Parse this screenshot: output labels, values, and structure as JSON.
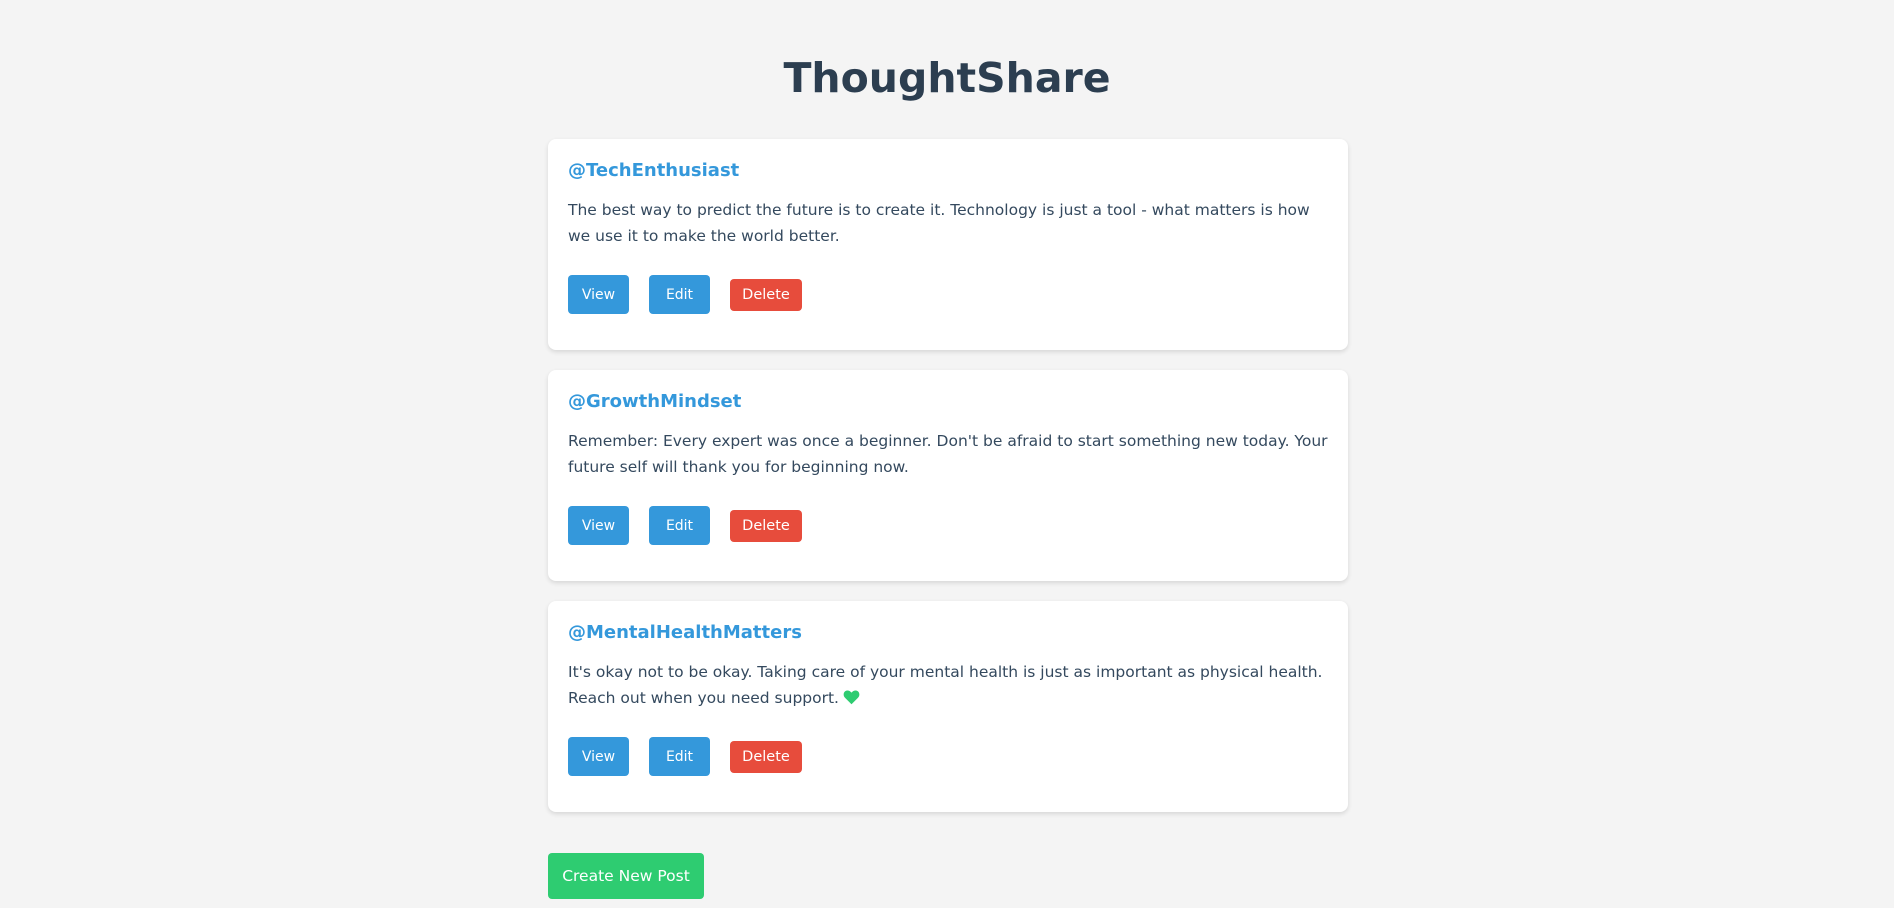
{
  "app": {
    "title": "ThoughtShare"
  },
  "posts": [
    {
      "author": "@TechEnthusiast",
      "text": "The best way to predict the future is to create it. Technology is just a tool - what matters is how we use it to make the world better.",
      "view_label": "View",
      "edit_label": "Edit",
      "delete_label": "Delete"
    },
    {
      "author": "@GrowthMindset",
      "text": "Remember: Every expert was once a beginner. Don't be afraid to start something new today. Your future self will thank you for beginning now.",
      "view_label": "View",
      "edit_label": "Edit",
      "delete_label": "Delete"
    },
    {
      "author": "@MentalHealthMatters",
      "text": "It's okay not to be okay. Taking care of your mental health is just as important as physical health. Reach out when you need support.",
      "emoji": "green-heart-icon",
      "view_label": "View",
      "edit_label": "Edit",
      "delete_label": "Delete"
    }
  ],
  "footer": {
    "create_label": "Create New Post"
  },
  "colors": {
    "background": "#f4f4f4",
    "title": "#2c3e50",
    "author": "#3498db",
    "primary_button": "#3498db",
    "danger_button": "#e74c3c",
    "create_button": "#2ecc71",
    "heart": "#2ecc71"
  }
}
